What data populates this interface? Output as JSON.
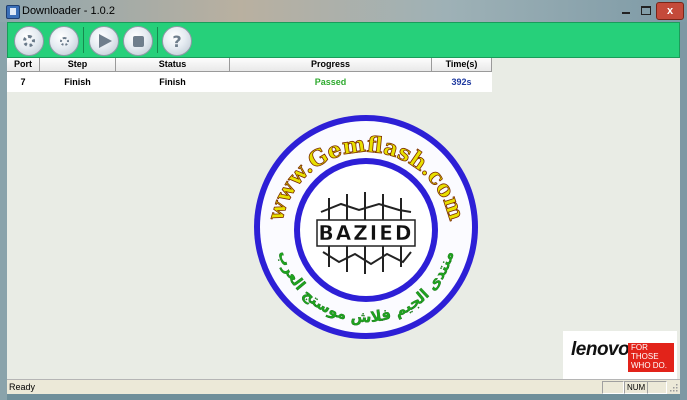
{
  "window": {
    "title": "Downloader - 1.0.2",
    "close_glyph": "x",
    "minimize_icon": "minimize-icon",
    "maximize_icon": "maximize-icon",
    "close_icon": "close-icon"
  },
  "toolbar": {
    "buttons": [
      {
        "icon": "settings-gear-icon"
      },
      {
        "icon": "advanced-gears-icon"
      },
      {
        "icon": "start-arrow-icon"
      },
      {
        "icon": "stop-icon"
      },
      {
        "icon": "help-icon",
        "glyph": "?"
      }
    ],
    "accent_color": "#26d07a"
  },
  "table": {
    "headers": {
      "port": "Port",
      "step": "Step",
      "status": "Status",
      "progress": "Progress",
      "time": "Time(s)"
    },
    "rows": [
      {
        "port": "7",
        "step": "Finish",
        "status": "Finish",
        "progress": "Passed",
        "time": "392s"
      }
    ],
    "passed_color": "#2eaa2e",
    "time_color": "#1f3aa0"
  },
  "logo": {
    "ring_top_text": "www.Gemflash.com",
    "badge_text": "BAZIED",
    "ring_arabic_text": "منتدى الجيم فلاش موستج العرب"
  },
  "lenovo": {
    "brand": "lenovo",
    "tagline_1": "FOR",
    "tagline_2": "THOSE",
    "tagline_3": "WHO DO."
  },
  "statusbar": {
    "status": "Ready",
    "num_indicator": "NUM"
  }
}
